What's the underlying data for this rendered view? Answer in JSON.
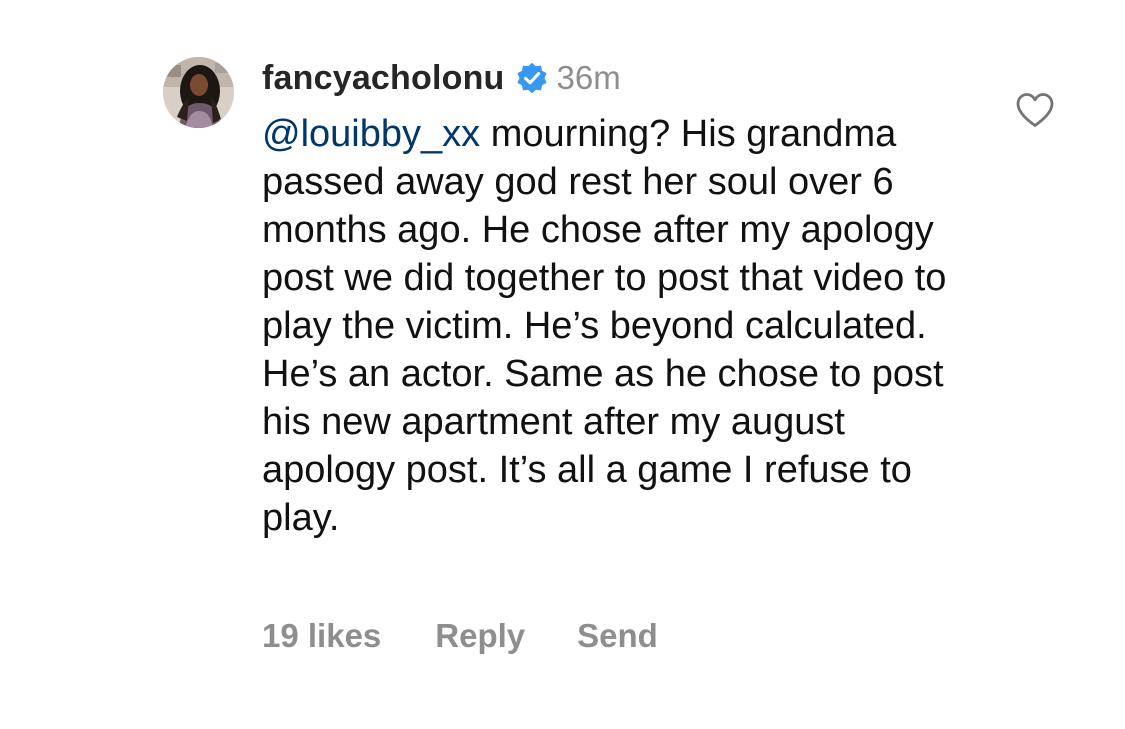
{
  "comment": {
    "username": "fancyacholonu",
    "verified": true,
    "time": "36m",
    "mention": "@louibby_xx",
    "text": " mourning? His grandma passed away god rest her soul over 6 months ago. He chose after my apology post we did together to post that video to play the victim. He’s beyond calculated. He’s an actor. Same as he chose to post his new apartment after my august apology post. It’s all a game I refuse to play.",
    "likes_label": "19 likes",
    "reply_label": "Reply",
    "send_label": "Send"
  },
  "icons": {
    "verified": "verified-badge-icon",
    "like": "heart-outline-icon"
  },
  "colors": {
    "verified_blue": "#3897f0",
    "mention": "#00376b",
    "secondary_text": "#8e8e8e",
    "username": "#262626"
  }
}
